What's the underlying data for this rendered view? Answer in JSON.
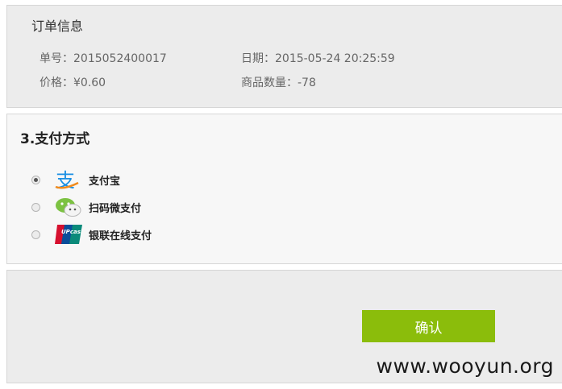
{
  "order": {
    "title": "订单信息",
    "order_no_label": "单号：",
    "order_no_value": "2015052400017",
    "date_label": "日期：",
    "date_value": "2015-05-24 20:25:59",
    "price_label": "价格：",
    "price_value": "¥0.60",
    "quantity_label": "商品数量：",
    "quantity_value": "-78"
  },
  "payment": {
    "title": "3.支付方式",
    "methods": [
      {
        "label": "支付宝",
        "icon": "alipay-icon",
        "selected": true
      },
      {
        "label": "扫码微支付",
        "icon": "wechat-pay-icon",
        "selected": false
      },
      {
        "label": "银联在线支付",
        "icon": "unionpay-icon",
        "selected": false
      }
    ]
  },
  "confirm": {
    "label": "确认"
  },
  "watermark": "www.wooyun.org",
  "colors": {
    "accent": "#8bbd0b",
    "panel_bg": "#ececec"
  }
}
